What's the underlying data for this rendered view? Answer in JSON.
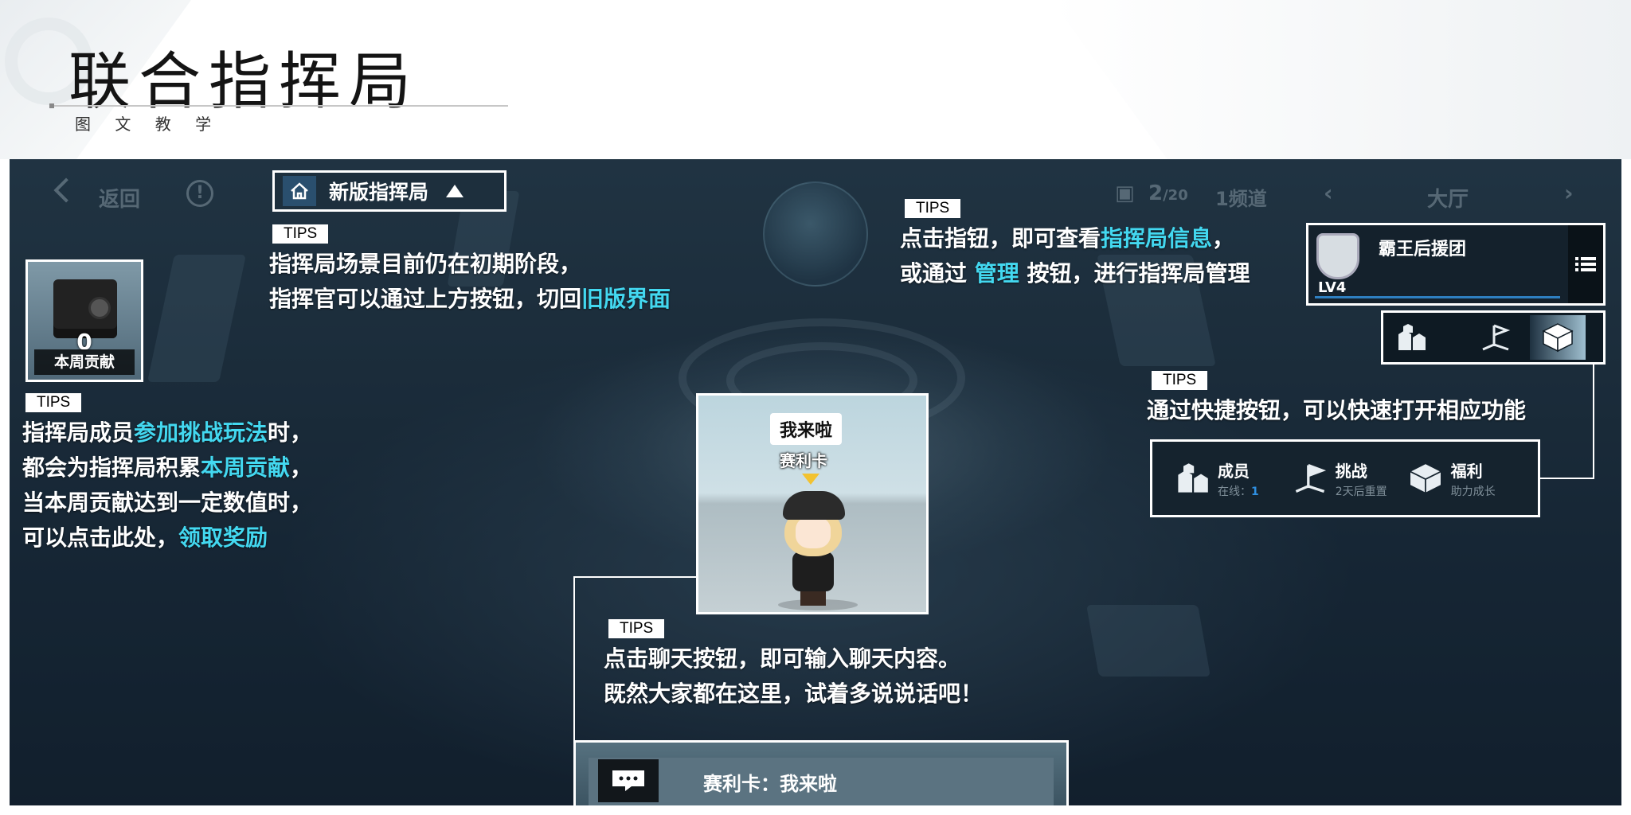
{
  "header": {
    "title": "联合指挥局",
    "subtitle": "图 文 教 学"
  },
  "game_ui": {
    "back_label": "返回",
    "info_glyph": "!",
    "switch_button_label": "新版指挥局",
    "online_count": "2",
    "online_max": "/20",
    "channel": "1频道",
    "lobby": "大厅",
    "contribution": {
      "value": "0",
      "label": "本周贡献"
    },
    "guild": {
      "name": "霸王后援团",
      "level": "LV4"
    },
    "quick_panel": [
      {
        "title": "成员",
        "sub_prefix": "在线：",
        "sub_value": "1",
        "icon": "members-icon"
      },
      {
        "title": "挑战",
        "sub_prefix": "2天后重置",
        "sub_value": "",
        "icon": "challenge-flag-icon"
      },
      {
        "title": "福利",
        "sub_prefix": "助力成长",
        "sub_value": "",
        "icon": "welfare-box-icon"
      }
    ],
    "character": {
      "speech": "我来啦",
      "name": "赛利卡"
    },
    "chat": {
      "message": "赛利卡：我来啦"
    }
  },
  "tips": {
    "tag": "TIPS",
    "switch_tip": {
      "line1": "指挥局场景目前仍在初期阶段，",
      "line2_pre": "指挥官可以通过上方按钮，切回",
      "line2_hi": "旧版界面"
    },
    "contribution_tip": {
      "l1_pre": "指挥局成员",
      "l1_hi": "参加挑战玩法",
      "l1_post": "时，",
      "l2_pre": "都会为指挥局积累",
      "l2_hi": "本周贡献",
      "l2_post": "，",
      "l3": "当本周贡献达到一定数值时，",
      "l4_pre": "可以点击此处，",
      "l4_hi": "领取奖励"
    },
    "info_tip": {
      "l1_pre": "点击指钮，即可查看",
      "l1_hi": "指挥局信息",
      "l1_post": "，",
      "l2_pre": "或通过 ",
      "l2_hi": "管理",
      "l2_post": " 按钮，进行指挥局管理"
    },
    "shortcut_tip": {
      "line": "通过快捷按钮，可以快速打开相应功能"
    },
    "chat_tip": {
      "line1": "点击聊天按钮，即可输入聊天内容。",
      "line2": "既然大家都在这里，试着多说说话吧！"
    }
  }
}
